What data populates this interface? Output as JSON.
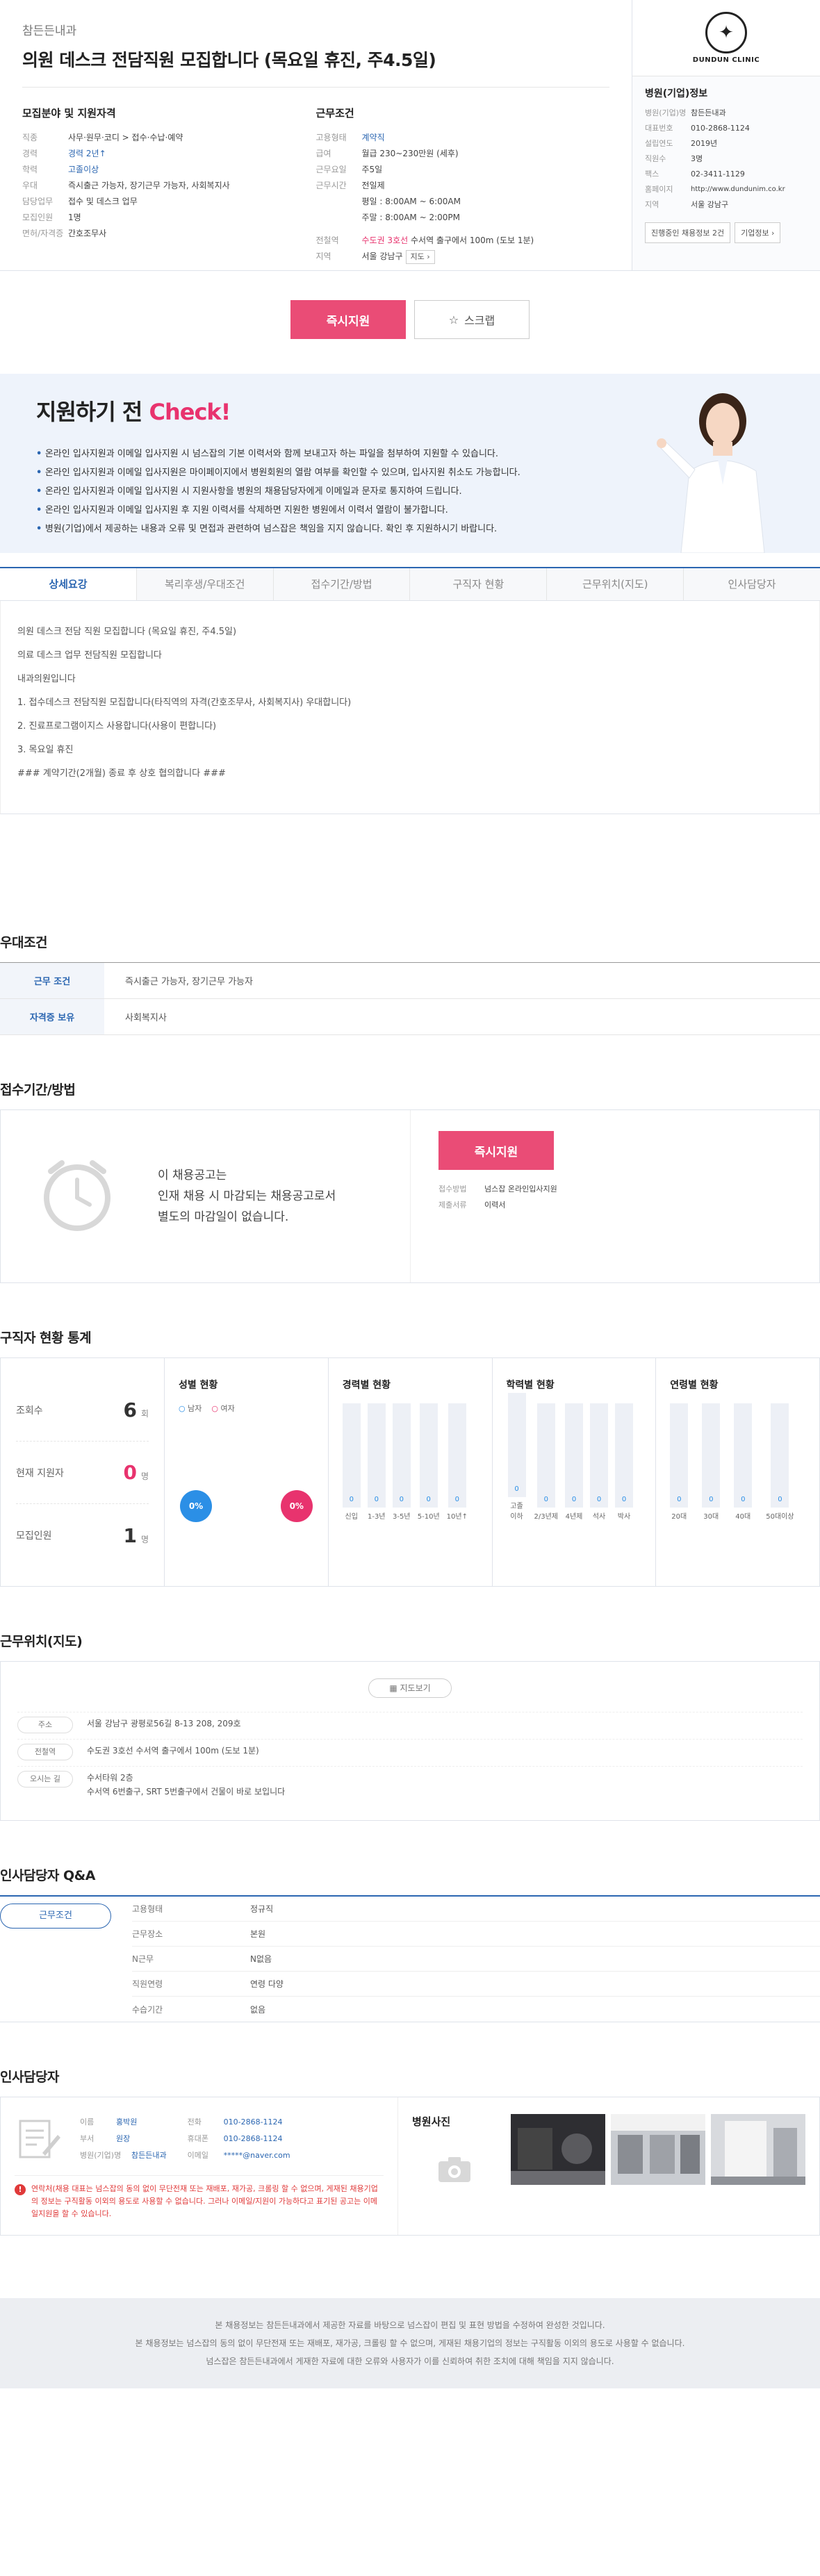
{
  "header": {
    "company": "참든든내과",
    "title": "의원 데스크 전담직원 모집합니다 (목요일 휴진, 주4.5일)",
    "recruit_section": "모집분야 및 지원자격",
    "work_section": "근무조건",
    "recruit": [
      {
        "k": "직종",
        "v": "사무·원무·코디 > 접수·수납·예약",
        "blue": false
      },
      {
        "k": "경력",
        "v": "경력 2년↑",
        "blue": true
      },
      {
        "k": "학력",
        "v": "고졸이상",
        "blue": true
      },
      {
        "k": "우대",
        "v": "즉시출근 가능자, 장기근무 가능자, 사회복지사",
        "blue": false
      },
      {
        "k": "담당업무",
        "v": "접수 및 데스크 업무",
        "blue": false
      },
      {
        "k": "모집인원",
        "v": "1명",
        "blue": false
      },
      {
        "k": "면허/자격증",
        "v": "간호조무사",
        "blue": false
      }
    ],
    "work": {
      "type_k": "고용형태",
      "type_v": "계약직",
      "salary_k": "급여",
      "salary_v": "월급 230~230만원 (세후)",
      "days_k": "근무요일",
      "days_v": "주5일",
      "time_k": "근무시간",
      "time_v1": "전일제",
      "time_v2": "평일 : 8:00AM ~ 6:00AM",
      "time_v3": "주말 : 8:00AM ~ 2:00PM",
      "subway_k": "전철역",
      "subway_line": "수도권 3호선",
      "subway_v": "수서역 출구에서 100m (도보 1분)",
      "area_k": "지역",
      "area_v": "서울 강남구",
      "area_btn": "지도 ›"
    }
  },
  "hospital": {
    "logo_text": "DUNDUN CLINIC",
    "title": "병원(기업)정보",
    "rows": [
      {
        "k": "병원(기업)명",
        "v": "참든든내과"
      },
      {
        "k": "대표번호",
        "v": "010-2868-1124"
      },
      {
        "k": "설립연도",
        "v": "2019년"
      },
      {
        "k": "직원수",
        "v": "3명"
      },
      {
        "k": "팩스",
        "v": "02-3411-1129"
      },
      {
        "k": "홈페이지",
        "v": "http://www.dundunim.co.kr"
      },
      {
        "k": "지역",
        "v": "서울 강남구"
      }
    ],
    "btn_jobs": "진행중인 채용정보 2건",
    "btn_jobs_count": "2건",
    "btn_info": "기업정보 ›"
  },
  "apply": {
    "apply_label": "즉시지원",
    "scrap_label": "스크랩"
  },
  "check": {
    "title_a": "지원하기 전 ",
    "title_b": "Check!",
    "items": [
      "온라인 입사지원과 이메일 입사지원 시 넘스잡의 기본 이력서와 함께 보내고자 하는 파일을 첨부하여 지원할 수 있습니다.",
      "온라인 입사지원과 이메일 입사지원은 마이페이지에서 병원회원의 열람 여부를 확인할 수 있으며, 입사지원 취소도 가능합니다.",
      "온라인 입사지원과 이메일 입사지원 시 지원사항을 병원의 채용담당자에게 이메일과 문자로 통지하여 드립니다.",
      "온라인 입사지원과 이메일 입사지원 후 지원 이력서를 삭제하면 지원한 병원에서 이력서 열람이 불가합니다.",
      "병원(기업)에서 제공하는 내용과 오류 및 면접과 관련하여 넘스잡은 책임을 지지 않습니다. 확인 후 지원하시기 바랍니다."
    ]
  },
  "tabs": [
    "상세요강",
    "복리후생/우대조건",
    "접수기간/방법",
    "구직자 현황",
    "근무위치(지도)",
    "인사담당자"
  ],
  "detail": [
    "의원 데스크 전담 직원 모집합니다 (목요일 휴진, 주4.5일)",
    "의료 데스크 업무 전담직원 모집합니다",
    "내과의원입니다",
    "1. 접수데스크 전담직원 모집합니다(타직역의 자격(간호조무사, 사회복지사) 우대합니다)",
    "2. 진료프로그램이지스 사용합니다(사용이 편합니다)",
    "3. 목요일 휴진",
    "### 계약기간(2개월) 종료 후 상호 협의합니다 ###"
  ],
  "preference": {
    "title": "우대조건",
    "rows": [
      {
        "k": "근무 조건",
        "v": "즉시출근 가능자, 장기근무 가능자"
      },
      {
        "k": "자격증 보유",
        "v": "사회복지사"
      }
    ]
  },
  "receipt": {
    "title": "접수기간/방법",
    "line1": "이 채용공고는",
    "line2": "인재 채용 시 마감되는 채용공고로서",
    "line3": "별도의 마감일이 없습니다.",
    "apply_label": "즉시지원",
    "method_k": "접수방법",
    "method_v": "넘스잡 온라인입사지원",
    "docs_k": "제출서류",
    "docs_v": "이력서"
  },
  "stats": {
    "title": "구직자 현황 통계",
    "views_k": "조회수",
    "views_v": "6",
    "views_unit": "회",
    "applicants_k": "현재 지원자",
    "applicants_v": "0",
    "applicants_unit": "명",
    "recruit_k": "모집인원",
    "recruit_v": "1",
    "recruit_unit": "명",
    "gender_title": "성별 현황",
    "male": "남자",
    "female": "여자",
    "male_pct": "0%",
    "female_pct": "0%",
    "career_title": "경력별 현황",
    "career": [
      {
        "lbl": "신입",
        "n": "0"
      },
      {
        "lbl": "1-3년",
        "n": "0"
      },
      {
        "lbl": "3-5년",
        "n": "0"
      },
      {
        "lbl": "5-10년",
        "n": "0"
      },
      {
        "lbl": "10년↑",
        "n": "0"
      }
    ],
    "edu_title": "학력별 현황",
    "edu": [
      {
        "lbl": "고졸 이하",
        "n": "0"
      },
      {
        "lbl": "2/3년제",
        "n": "0"
      },
      {
        "lbl": "4년제",
        "n": "0"
      },
      {
        "lbl": "석사",
        "n": "0"
      },
      {
        "lbl": "박사",
        "n": "0"
      }
    ],
    "age_title": "연령별 현황",
    "age": [
      {
        "lbl": "20대",
        "n": "0"
      },
      {
        "lbl": "30대",
        "n": "0"
      },
      {
        "lbl": "40대",
        "n": "0"
      },
      {
        "lbl": "50대이상",
        "n": "0"
      }
    ]
  },
  "map": {
    "title": "근무위치(지도)",
    "btn": "지도보기",
    "addr_k": "주소",
    "addr_v": "서울 강남구 광평로56길 8-13 208, 209호",
    "subway_k": "전철역",
    "subway_v": "수도권 3호선 수서역 출구에서 100m (도보 1분)",
    "way_k": "오시는 길",
    "way_v1": "수서타워 2층",
    "way_v2": "수서역 6번출구, SRT 5번출구에서 건물이 바로 보입니다"
  },
  "qa": {
    "title": "인사담당자 Q&A",
    "tab": "근무조건",
    "rows": [
      {
        "k": "고용형태",
        "v": "정규직"
      },
      {
        "k": "근무장소",
        "v": "본원"
      },
      {
        "k": "N근무",
        "v": "N없음"
      },
      {
        "k": "직원연령",
        "v": "연령 다양"
      },
      {
        "k": "수습기간",
        "v": "없음"
      }
    ]
  },
  "contact": {
    "title": "인사담당자",
    "name_k": "이름",
    "name_v": "홍박원",
    "dept_k": "부서",
    "dept_v": "원장",
    "company_k": "병원(기업)명",
    "company_v": "참든든내과",
    "tel_k": "전화",
    "tel_v": "010-2868-1124",
    "mobile_k": "휴대폰",
    "mobile_v": "010-2868-1124",
    "email_k": "이메일",
    "email_v": "*****@naver.com",
    "notice": "연락처(채용 대표는 넘스잡의 동의 없이 무단전재 또는 재배포, 재가공, 크롤링 할 수 없으며, 게재된 채용기업의 정보는 구직활동 이외의 용도로 사용할 수 없습니다. 그러나 이메일/지원이 가능하다고 표기된 공고는 이메일지원을 할 수 있습니다.",
    "photo_title": "병원사진"
  },
  "footer": {
    "line1": "본 채용정보는 참든든내과에서 제공한 자료를 바탕으로 넘스잡이 편집 및 표현 방법을 수정하여 완성한 것입니다.",
    "line2": "본 채용정보는 넘스잡의 동의 없이 무단전재 또는 재배포, 재가공, 크롤링 할 수 없으며, 게재된 채용기업의 정보는 구직활동 이외의 용도로 사용할 수 없습니다.",
    "line3": "넘스잡은 참든든내과에서 게재한 자료에 대한 오류와 사용자가 이를 신뢰하여 취한 조치에 대해 책임을 지지 않습니다."
  },
  "colors": {
    "accent": "#2b66b1",
    "brand": "#ea4c76"
  }
}
